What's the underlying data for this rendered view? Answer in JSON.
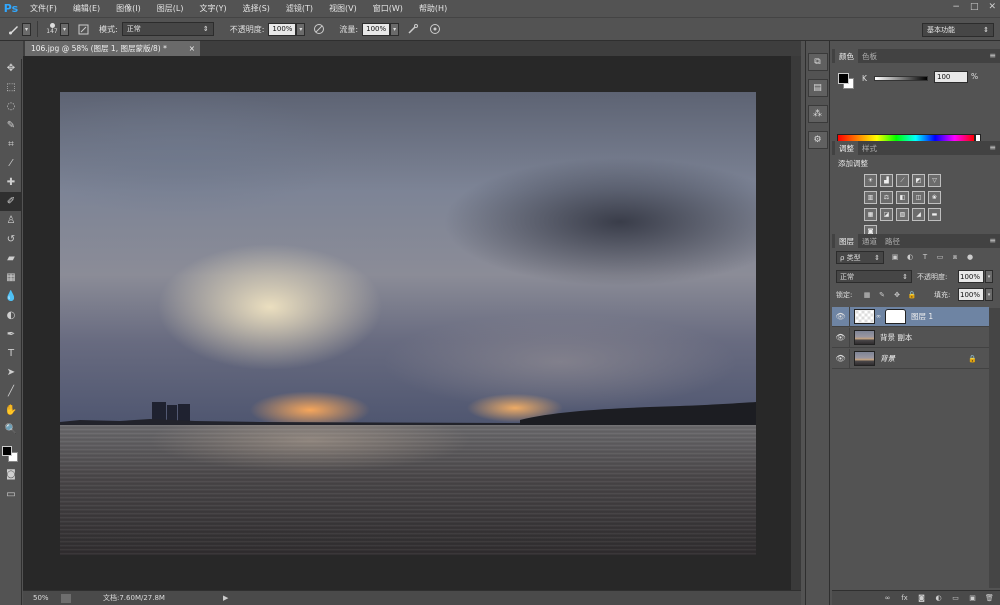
{
  "app": {
    "logo": "Ps"
  },
  "menu": [
    "文件(F)",
    "编辑(E)",
    "图像(I)",
    "图层(L)",
    "文字(Y)",
    "选择(S)",
    "滤镜(T)",
    "视图(V)",
    "窗口(W)",
    "帮助(H)"
  ],
  "window_controls": [
    "−",
    "□",
    "✕"
  ],
  "options": {
    "brush_size": "147",
    "mode_label": "模式:",
    "mode_value": "正常",
    "opacity_label": "不透明度:",
    "opacity_value": "100%",
    "flow_label": "流量:",
    "flow_value": "100%",
    "workspace": "基本功能"
  },
  "document": {
    "tab_title": "106.jpg @ 58% (图层 1, 图层蒙版/8) *",
    "close": "×",
    "zoom": "50%",
    "doc_info": "文档:7.60M/27.8M"
  },
  "color_panel": {
    "tabs": [
      "颜色",
      "色板"
    ],
    "channel_label": "K",
    "channel_value": "100",
    "unit": "%"
  },
  "adjustments_panel": {
    "tabs": [
      "调整",
      "样式"
    ],
    "title": "添加调整"
  },
  "layers_panel": {
    "tabs": [
      "图层",
      "通道",
      "路径"
    ],
    "filter": "ρ 类型",
    "blend_mode": "正常",
    "opacity_label": "不透明度:",
    "opacity_value": "100%",
    "lock_label": "锁定:",
    "fill_label": "填充:",
    "fill_value": "100%",
    "layers": [
      {
        "name": "图层 1",
        "selected": true
      },
      {
        "name": "背景 副本",
        "selected": false
      },
      {
        "name": "背景",
        "selected": false,
        "locked": true
      }
    ],
    "footer_icons": [
      "link-icon",
      "fx-icon",
      "mask-icon",
      "adjustment-icon",
      "group-icon",
      "new-layer-icon",
      "delete-icon"
    ]
  },
  "colors": {
    "chrome": "#535353",
    "canvas_bg": "#282828",
    "selected_layer": "#6e84a3",
    "ps_blue": "#31a8ff"
  }
}
